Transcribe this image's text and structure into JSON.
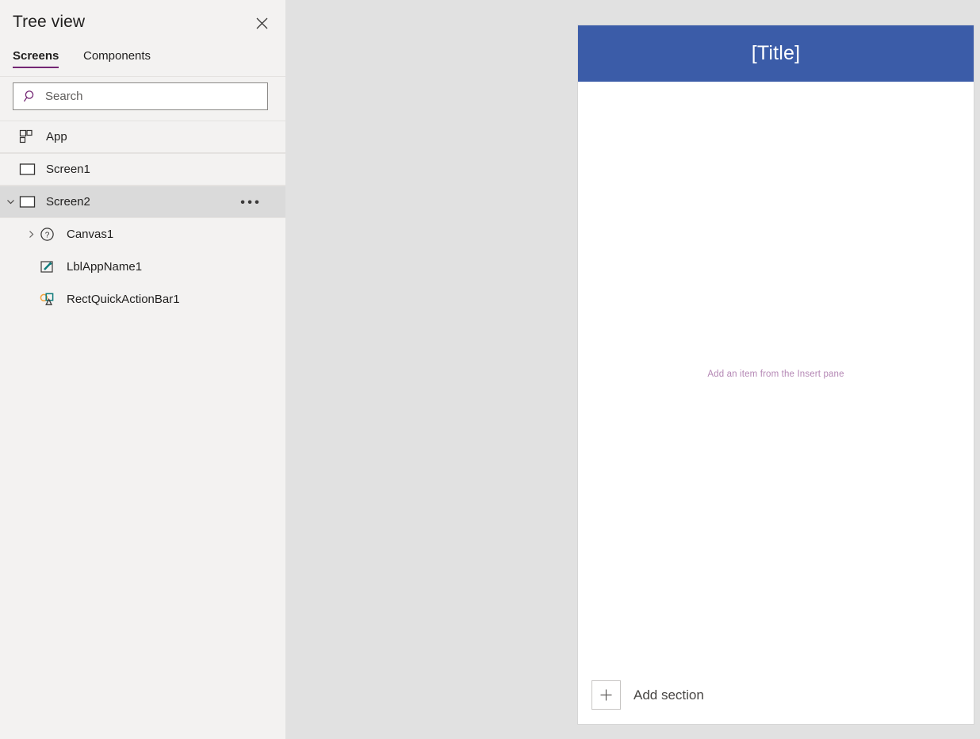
{
  "panel": {
    "title": "Tree view",
    "close_icon": "close-icon",
    "tabs": [
      {
        "label": "Screens",
        "active": true
      },
      {
        "label": "Components",
        "active": false
      }
    ],
    "search": {
      "placeholder": "Search",
      "value": "",
      "icon": "search-icon"
    },
    "tree": [
      {
        "label": "App",
        "icon": "app-grid-icon",
        "indent": 0,
        "twisty": "none",
        "selected": false,
        "menu": false
      },
      {
        "label": "Screen1",
        "icon": "screen-icon",
        "indent": 0,
        "twisty": "none",
        "selected": false,
        "menu": false
      },
      {
        "label": "Screen2",
        "icon": "screen-icon",
        "indent": 0,
        "twisty": "chevron-down",
        "selected": true,
        "menu": true
      },
      {
        "label": "Canvas1",
        "icon": "question-circle-icon",
        "indent": 1,
        "twisty": "chevron-right",
        "selected": false,
        "menu": false
      },
      {
        "label": "LblAppName1",
        "icon": "label-pencil-icon",
        "indent": 1,
        "twisty": "none",
        "selected": false,
        "menu": false
      },
      {
        "label": "RectQuickActionBar1",
        "icon": "shapes-icon",
        "indent": 1,
        "twisty": "none",
        "selected": false,
        "menu": false
      }
    ],
    "row_menu_glyph": "•••"
  },
  "canvas": {
    "title_text": "[Title]",
    "placeholder_text": "Add an item from the Insert pane",
    "add_section_label": "Add section",
    "add_section_icon": "plus-icon"
  },
  "colors": {
    "panel_background": "#f3f2f1",
    "workspace_background": "#e1e1e1",
    "accent_purple": "#742774",
    "selected_row": "#dadada",
    "title_bar_blue": "#3b5ca8",
    "placeholder_mauve": "#b487b4",
    "icon_teal": "#0f7b7b",
    "icon_orange": "#f2a33c"
  }
}
